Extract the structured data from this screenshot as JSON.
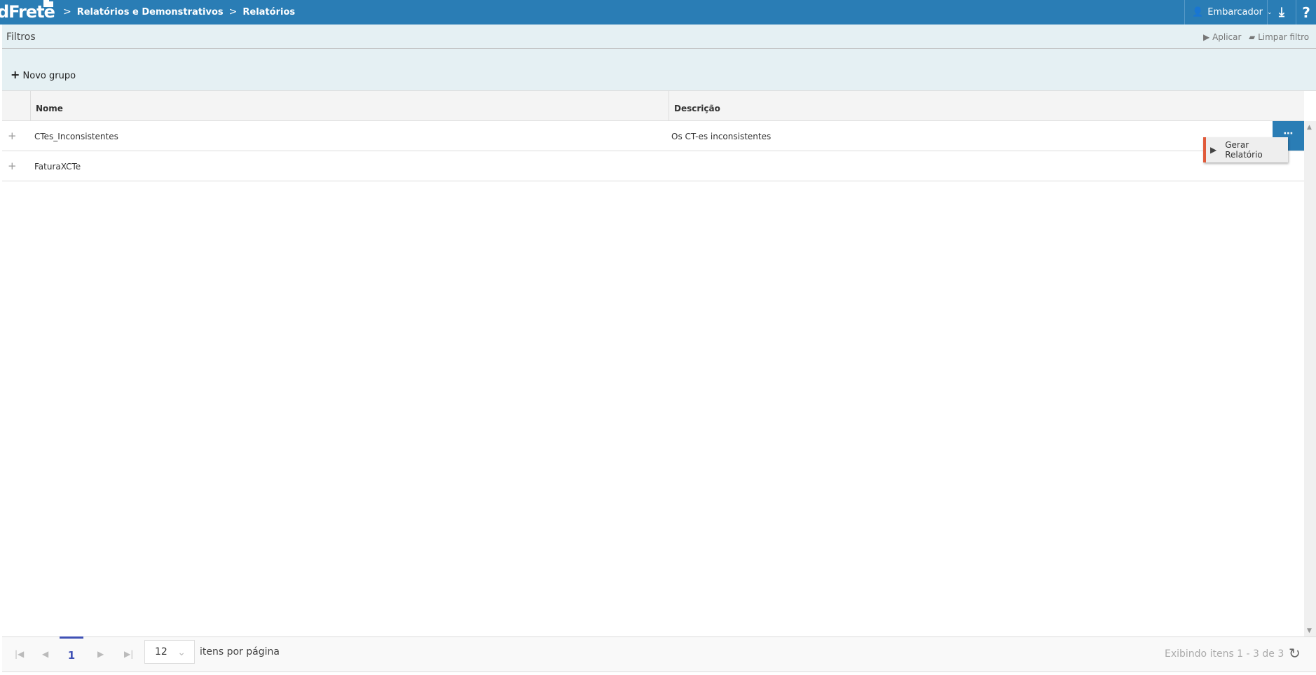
{
  "header": {
    "logo": "dFrete",
    "breadcrumb": [
      "Relatórios e Demonstrativos",
      "Relatórios"
    ],
    "user": "Embarcador",
    "icons": [
      "download-icon",
      "help-icon"
    ],
    "help_label": "?"
  },
  "filters": {
    "title": "Filtros",
    "apply": "Aplicar",
    "clear": "Limpar filtro"
  },
  "group": {
    "new_group": "Novo grupo"
  },
  "table": {
    "columns": [
      "Nome",
      "Descrição"
    ],
    "rows": [
      {
        "name": "CTes_Inconsistentes",
        "description": "Os CT-es inconsistentes"
      },
      {
        "name": "FaturaXCTe",
        "description": ""
      }
    ],
    "action_menu": {
      "label": "Gerar Relatório"
    }
  },
  "pager": {
    "current_page": "1",
    "page_size": "12",
    "page_size_label": "itens por página",
    "info": "Exibindo itens 1 - 3 de 3"
  },
  "colors": {
    "brand": "#2a7db5",
    "filter_bg": "#e5f0f3",
    "menu_accent": "#e05a3a",
    "pager_active": "#3f51b5"
  }
}
